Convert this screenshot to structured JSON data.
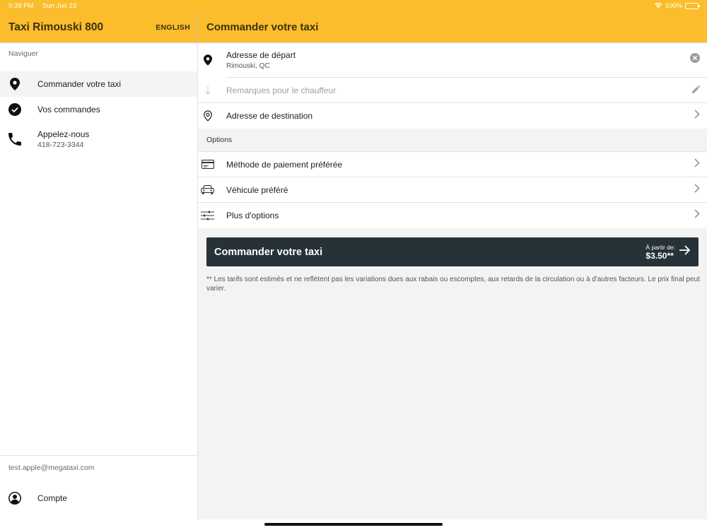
{
  "status_bar": {
    "time": "9:39 PM",
    "date": "Sun Jun 23",
    "battery": "100%"
  },
  "sidebar": {
    "app_title": "Taxi Rimouski 800",
    "language_button": "ENGLISH",
    "nav_caption": "Naviguer",
    "items": [
      {
        "label": "Commander votre taxi",
        "icon": "location-pin-icon"
      },
      {
        "label": "Vos commandes",
        "icon": "check-circle-icon"
      },
      {
        "label": "Appelez-nous",
        "sub": "418-723-3344",
        "icon": "phone-icon"
      }
    ],
    "account_email": "test.apple@megataxi.com",
    "account_label": "Compte"
  },
  "main": {
    "title": "Commander votre taxi",
    "pickup": {
      "label": "Adresse de départ",
      "value": "Rimouski, QC"
    },
    "driver_notes": {
      "placeholder": "Remarques pour le chauffeur"
    },
    "destination": {
      "label": "Adresse de destination"
    },
    "options_caption": "Options",
    "options": [
      {
        "label": "Méthode de paiement préférée",
        "icon": "credit-card-icon"
      },
      {
        "label": "Véhicule préféré",
        "icon": "car-icon"
      },
      {
        "label": "Plus d'options",
        "icon": "sliders-icon"
      }
    ],
    "book_button": {
      "label": "Commander votre taxi",
      "price_caption": "À partir de:",
      "price": "$3.50**"
    },
    "disclaimer": "** Les tarifs sont estimés et ne reflètent pas les variations dues aux rabais ou escomptes, aux retards de la circulation ou à d'autres facteurs. Le prix final peut varier."
  },
  "colors": {
    "accent": "#fbbd2c",
    "button": "#263238",
    "background": "#f3f3f3"
  }
}
